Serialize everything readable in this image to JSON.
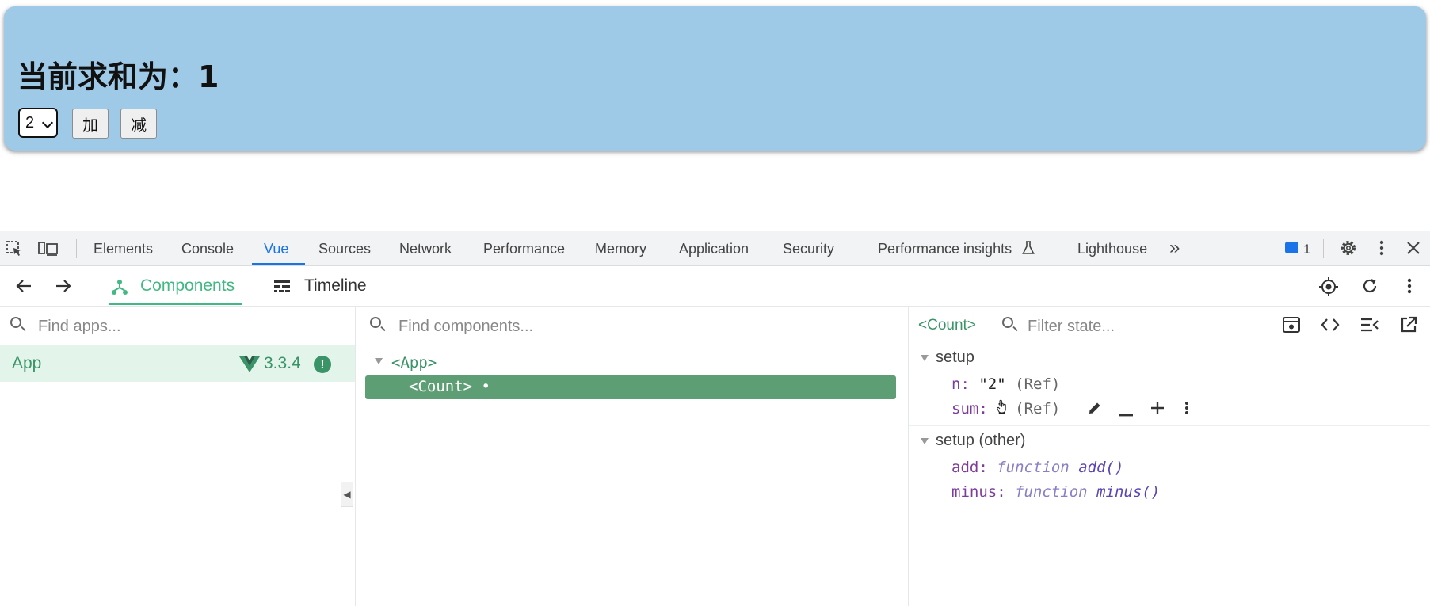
{
  "page": {
    "title_prefix": "当前求和为：",
    "sum_value": "1",
    "step_select_value": "2",
    "add_button": "加",
    "minus_button": "减"
  },
  "devtools": {
    "tabs": [
      "Elements",
      "Console",
      "Vue",
      "Sources",
      "Network",
      "Performance",
      "Memory",
      "Application",
      "Security",
      "Performance insights",
      "Lighthouse"
    ],
    "active_tab": "Vue",
    "more_tabs": "»",
    "issues_count": "1"
  },
  "vue": {
    "subtabs": {
      "components": "Components",
      "timeline": "Timeline"
    },
    "apps_search_placeholder": "Find apps...",
    "components_search_placeholder": "Find components...",
    "state_filter_placeholder": "Filter state...",
    "app": {
      "name": "App",
      "version": "3.3.4"
    },
    "tree": {
      "root": "<App>",
      "child": "<Count>",
      "child_marker": "•"
    },
    "selected_component": "<Count>",
    "sections": [
      {
        "title": "setup",
        "props": [
          {
            "key": "n",
            "value": "\"2\"",
            "type": "(Ref)"
          },
          {
            "key": "sum",
            "value": "1",
            "type": "(Ref)"
          }
        ]
      },
      {
        "title": "setup (other)",
        "props": [
          {
            "key": "add",
            "kind": "function",
            "value": "add()"
          },
          {
            "key": "minus",
            "kind": "function",
            "value": "minus()"
          }
        ]
      }
    ]
  },
  "colors": {
    "card_bg": "#9ecae8",
    "vue_green": "#42b883",
    "selected_row": "#5e9e74",
    "devtools_blue": "#1a73e8"
  }
}
